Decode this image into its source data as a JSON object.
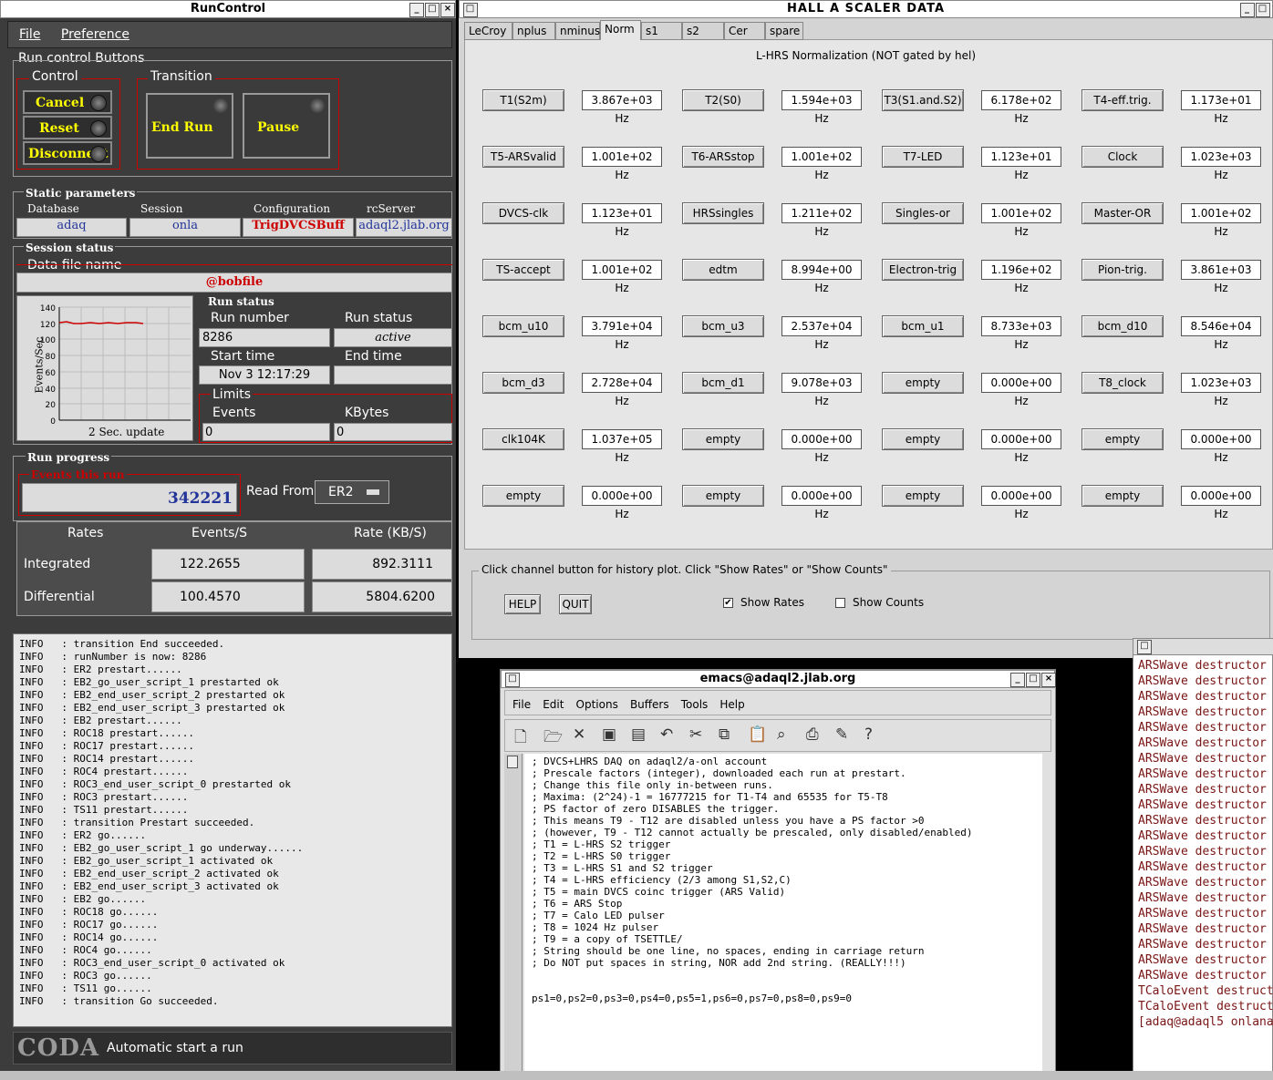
{
  "runcontrol": {
    "title": "RunControl",
    "menu": [
      "File",
      "Preference"
    ],
    "run_control_buttons_label": "Run control Buttons",
    "control_label": "Control",
    "control_buttons": [
      "Cancel",
      "Reset",
      "Disconnect"
    ],
    "transition_label": "Transition",
    "transition_buttons": [
      "End Run",
      "Pause"
    ],
    "static_params_label": "Static parameters",
    "static_params": [
      {
        "label": "Database",
        "value": "adaq"
      },
      {
        "label": "Session",
        "value": "onla"
      },
      {
        "label": "Configuration",
        "value": "TrigDVCSBuff"
      },
      {
        "label": "rcServer",
        "value": "adaql2.jlab.org"
      }
    ],
    "session_status_label": "Session status",
    "data_file_label": "Data file name",
    "data_file_value": "@bobfile",
    "plot": {
      "ylabel": "Events/Sec",
      "yticks": [
        "140",
        "120",
        "100",
        "80",
        "60",
        "40",
        "20",
        "0"
      ],
      "footer": "2 Sec. update"
    },
    "run_status_label": "Run status",
    "run_number_label": "Run number",
    "run_number_value": "8286",
    "run_status_field_label": "Run status",
    "run_status_value": "active",
    "start_time_label": "Start time",
    "start_time_value": "Nov 3 12:17:29",
    "end_time_label": "End time",
    "limits_label": "Limits",
    "events_label": "Events",
    "events_value": "0",
    "kbytes_label": "KBytes",
    "kbytes_value": "0",
    "run_progress_label": "Run progress",
    "events_this_run_label": "Events this run",
    "events_this_run_value": "342221",
    "read_from_label": "Read From:",
    "read_from_value": "ER2",
    "rates_header": [
      "Rates",
      "Events/S",
      "Rate (KB/S)"
    ],
    "rates_rows": [
      {
        "label": "Integrated",
        "events": "122.2655",
        "rate": "892.3111"
      },
      {
        "label": "Differential",
        "events": "100.4570",
        "rate": "5804.6200"
      }
    ],
    "log": [
      "INFO   : transition End succeeded.",
      "INFO   : runNumber is now: 8286",
      "INFO   : ER2 prestart......",
      "INFO   : EB2_go_user_script_1 prestarted ok",
      "INFO   : EB2_end_user_script_2 prestarted ok",
      "INFO   : EB2_end_user_script_3 prestarted ok",
      "INFO   : EB2 prestart......",
      "INFO   : ROC18 prestart......",
      "INFO   : ROC17 prestart......",
      "INFO   : ROC14 prestart......",
      "INFO   : ROC4 prestart......",
      "INFO   : ROC3_end_user_script_0 prestarted ok",
      "INFO   : ROC3 prestart......",
      "INFO   : TS11 prestart......",
      "INFO   : transition Prestart succeeded.",
      "INFO   : ER2 go......",
      "INFO   : EB2_go_user_script_1 go underway......",
      "INFO   : EB2_go_user_script_1 activated ok",
      "INFO   : EB2_end_user_script_2 activated ok",
      "INFO   : EB2_end_user_script_3 activated ok",
      "INFO   : EB2 go......",
      "INFO   : ROC18 go......",
      "INFO   : ROC17 go......",
      "INFO   : ROC14 go......",
      "INFO   : ROC4 go......",
      "INFO   : ROC3_end_user_script_0 activated ok",
      "INFO   : ROC3 go......",
      "INFO   : TS11 go......",
      "INFO   : transition Go succeeded."
    ],
    "logo": "CODA",
    "footer_text": "Automatic start a run"
  },
  "scaler": {
    "title": "HALL A SCALER DATA",
    "tabs": [
      "LeCroy",
      "nplus",
      "nminus",
      "Norm",
      "s1",
      "s2",
      "Cer",
      "spare"
    ],
    "active_tab": "Norm",
    "heading": "L-HRS Normalization (NOT gated by hel)",
    "channels": [
      [
        [
          "T1(S2m)",
          "3.867e+03 Hz"
        ],
        [
          "T2(S0)",
          "1.594e+03 Hz"
        ],
        [
          "T3(S1.and.S2)",
          "6.178e+02 Hz"
        ],
        [
          "T4-eff.trig.",
          "1.173e+01 Hz"
        ]
      ],
      [
        [
          "T5-ARSvalid",
          "1.001e+02 Hz"
        ],
        [
          "T6-ARSstop",
          "1.001e+02 Hz"
        ],
        [
          "T7-LED",
          "1.123e+01 Hz"
        ],
        [
          "Clock",
          "1.023e+03 Hz"
        ]
      ],
      [
        [
          "DVCS-clk",
          "1.123e+01 Hz"
        ],
        [
          "HRSsingles",
          "1.211e+02 Hz"
        ],
        [
          "Singles-or",
          "1.001e+02 Hz"
        ],
        [
          "Master-OR",
          "1.001e+02 Hz"
        ]
      ],
      [
        [
          "TS-accept",
          "1.001e+02 Hz"
        ],
        [
          "edtm",
          "8.994e+00 Hz"
        ],
        [
          "Electron-trig",
          "1.196e+02 Hz"
        ],
        [
          "Pion-trig.",
          "3.861e+03 Hz"
        ]
      ],
      [
        [
          "bcm_u10",
          "3.791e+04 Hz"
        ],
        [
          "bcm_u3",
          "2.537e+04 Hz"
        ],
        [
          "bcm_u1",
          "8.733e+03 Hz"
        ],
        [
          "bcm_d10",
          "8.546e+04 Hz"
        ]
      ],
      [
        [
          "bcm_d3",
          "2.728e+04 Hz"
        ],
        [
          "bcm_d1",
          "9.078e+03 Hz"
        ],
        [
          "empty",
          "0.000e+00 Hz"
        ],
        [
          "T8_clock",
          "1.023e+03 Hz"
        ]
      ],
      [
        [
          "clk104K",
          "1.037e+05 Hz"
        ],
        [
          "empty",
          "0.000e+00 Hz"
        ],
        [
          "empty",
          "0.000e+00 Hz"
        ],
        [
          "empty",
          "0.000e+00 Hz"
        ]
      ],
      [
        [
          "empty",
          "0.000e+00 Hz"
        ],
        [
          "empty",
          "0.000e+00 Hz"
        ],
        [
          "empty",
          "0.000e+00 Hz"
        ],
        [
          "empty",
          "0.000e+00 Hz"
        ]
      ]
    ],
    "hint": "Click channel button for history plot.  Click \"Show Rates\" or \"Show Counts\"",
    "help_label": "HELP",
    "quit_label": "QUIT",
    "show_rates_label": "Show Rates",
    "show_counts_label": "Show Counts",
    "show_rates_checked": true,
    "show_counts_checked": false
  },
  "emacs": {
    "title": "emacs@adaql2.jlab.org",
    "menu": [
      "File",
      "Edit",
      "Options",
      "Buffers",
      "Tools",
      "Help"
    ],
    "toolbar_icons": [
      "new-file-icon",
      "open-folder-icon",
      "close-icon",
      "save-icon",
      "save-as-icon",
      "undo-icon",
      "cut-icon",
      "copy-icon",
      "paste-icon",
      "search-icon",
      "print-icon",
      "preferences-icon",
      "help-icon"
    ],
    "buffer_lines": [
      "; DVCS+LHRS DAQ on adaql2/a-onl account",
      "; Prescale factors (integer), downloaded each run at prestart.",
      "; Change this file only in-between runs.",
      "; Maxima: (2^24)-1 = 16777215 for T1-T4 and 65535 for T5-T8",
      "; PS factor of zero DISABLES the trigger.",
      "; This means T9 - T12 are disabled unless you have a PS factor >0",
      "; (however, T9 - T12 cannot actually be prescaled, only disabled/enabled)",
      "; T1 = L-HRS S2 trigger",
      "; T2 = L-HRS S0 trigger",
      "; T3 = L-HRS S1 and S2 trigger",
      "; T4 = L-HRS efficiency (2/3 among S1,S2,C)",
      "; T5 = main DVCS coinc trigger (ARS Valid)",
      "; T6 = ARS Stop",
      "; T7 = Calo LED pulser",
      "; T8 = 1024 Hz pulser",
      "; T9 = a copy of TSETTLE/",
      "; String should be one line, no spaces, ending in carriage return",
      "; Do NOT put spaces in string, NOR add 2nd string. (REALLY!!!)",
      "",
      "",
      "ps1=0,ps2=0,ps3=0,ps4=0,ps5=1,ps6=0,ps7=0,ps8=0,ps9=0"
    ]
  },
  "xterm": {
    "lines": [
      "ARSWave destructor",
      "ARSWave destructor",
      "ARSWave destructor",
      "ARSWave destructor",
      "ARSWave destructor",
      "ARSWave destructor",
      "ARSWave destructor",
      "ARSWave destructor",
      "ARSWave destructor",
      "ARSWave destructor",
      "ARSWave destructor",
      "ARSWave destructor",
      "ARSWave destructor",
      "ARSWave destructor",
      "ARSWave destructor",
      "ARSWave destructor",
      "ARSWave destructor",
      "ARSWave destructor",
      "ARSWave destructor",
      "ARSWave destructor",
      "ARSWave destructor",
      "TCaloEvent destruct",
      "TCaloEvent destruct",
      "[adaq@adaql5 onlana"
    ]
  }
}
